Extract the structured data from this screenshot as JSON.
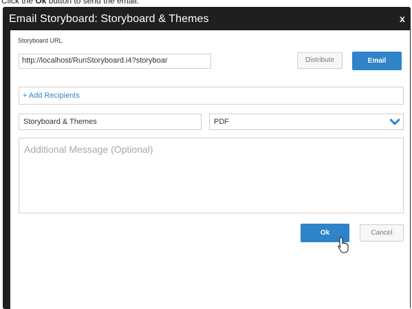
{
  "caption": {
    "prefix": "Click the ",
    "bold": "Ok",
    "suffix": " button to send the email."
  },
  "dialog": {
    "title": "Email Storyboard: Storyboard & Themes",
    "close_label": "x"
  },
  "form": {
    "url_label": "Storyboard URL",
    "url_value": "http://localhost/RunStoryboard.i4?storyboar",
    "distribute_label": "Distribute",
    "email_label": "Email",
    "recipients_label": "+ Add Recipients",
    "subject_value": "Storyboard & Themes",
    "format_value": "PDF",
    "message_placeholder": "Additional Message (Optional)",
    "ok_label": "Ok",
    "cancel_label": "Cancel"
  },
  "colors": {
    "primary": "#2f83c9",
    "titlebar": "#1f1f1f"
  },
  "icons": {
    "close": "close-icon",
    "dropdown": "chevron-down-icon",
    "cursor": "hand-pointer-icon"
  }
}
